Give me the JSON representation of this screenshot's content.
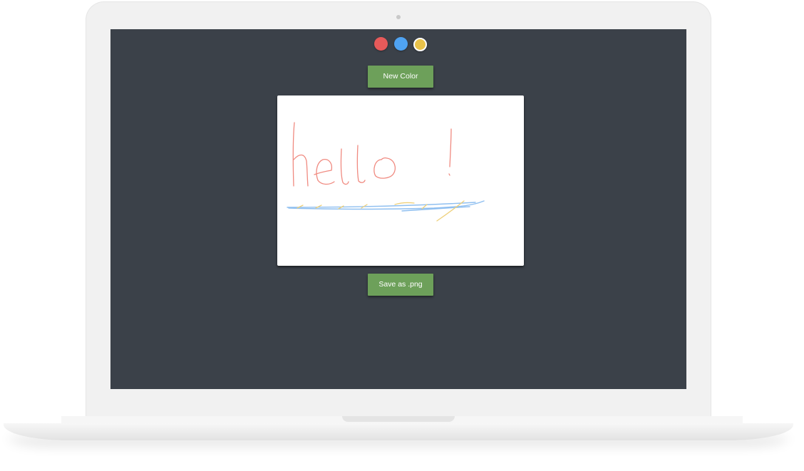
{
  "palette": {
    "colors": [
      "#e65a5a",
      "#4fa3f2",
      "#e8c24a"
    ],
    "selected_index": 2
  },
  "toolbar": {
    "new_color_label": "New Color",
    "save_label": "Save as .png"
  },
  "canvas": {
    "text_strokes": "hello !",
    "stroke_colors": [
      "#f08a80",
      "#8fbff0",
      "#eed07a"
    ]
  }
}
